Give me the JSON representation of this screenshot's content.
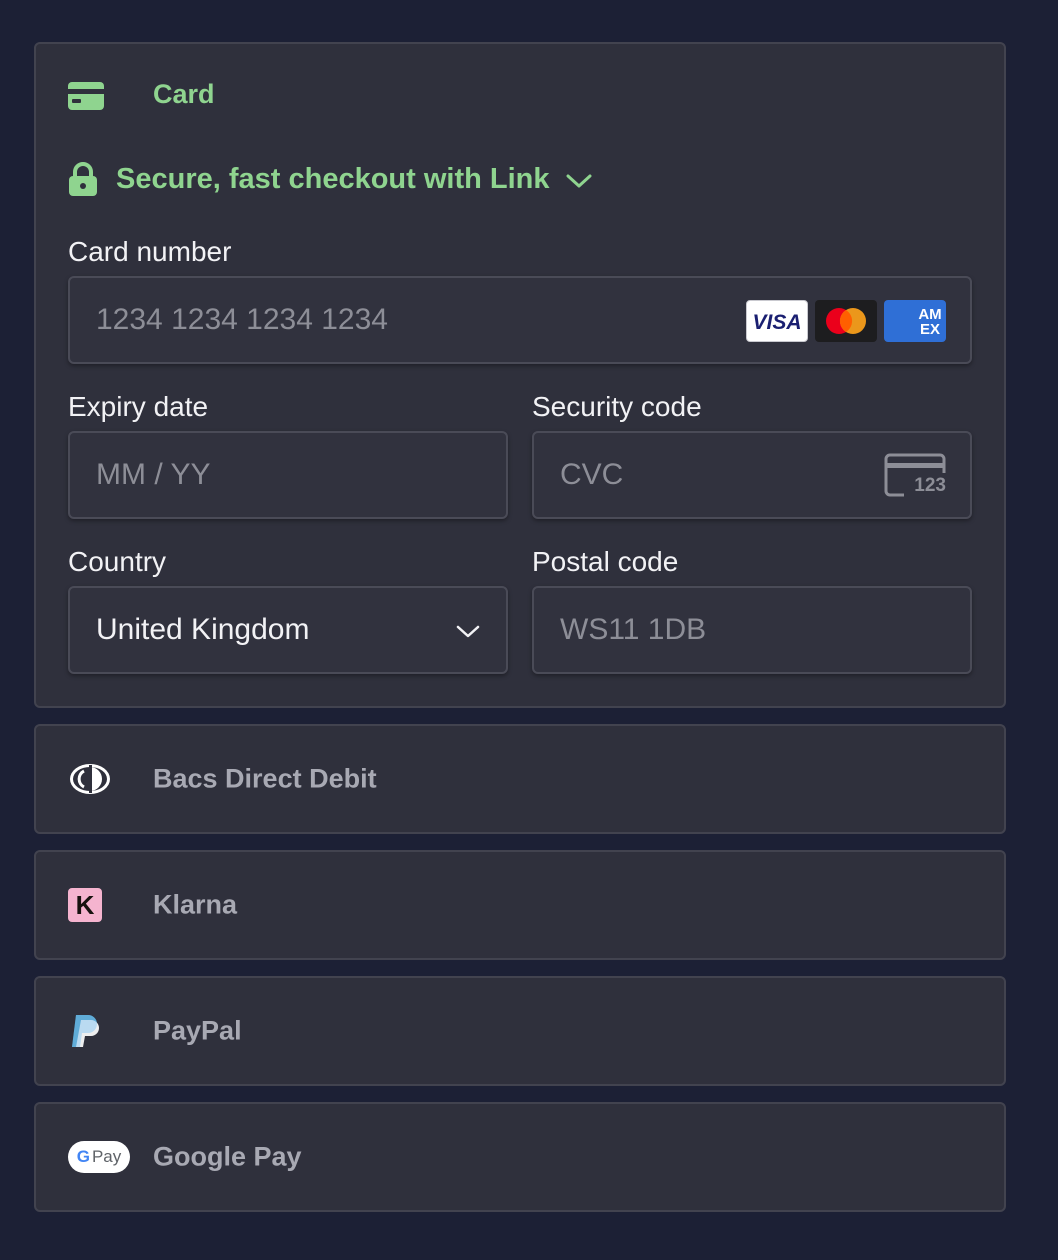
{
  "card": {
    "title": "Card",
    "link_text": "Secure, fast checkout with Link",
    "fields": {
      "card_number_label": "Card number",
      "card_number_placeholder": "1234 1234 1234 1234",
      "expiry_label": "Expiry date",
      "expiry_placeholder": "MM / YY",
      "security_label": "Security code",
      "security_placeholder": "CVC",
      "cvc_icon_text": "123",
      "country_label": "Country",
      "country_value": "United Kingdom",
      "postal_label": "Postal code",
      "postal_placeholder": "WS11 1DB"
    },
    "brands": {
      "visa": "VISA",
      "amex": "AM EX"
    }
  },
  "methods": [
    {
      "label": "Bacs Direct Debit",
      "icon": "bacs-icon"
    },
    {
      "label": "Klarna",
      "icon": "klarna-icon",
      "icon_text": "K"
    },
    {
      "label": "PayPal",
      "icon": "paypal-icon"
    },
    {
      "label": "Google Pay",
      "icon": "google-pay-icon",
      "icon_text": "Pay"
    }
  ],
  "colors": {
    "background": "#1c2035",
    "panel": "#2f303c",
    "accent_green": "#8fd48f",
    "klarna_pink": "#f5b4cf",
    "amex_blue": "#2f6fd6"
  }
}
